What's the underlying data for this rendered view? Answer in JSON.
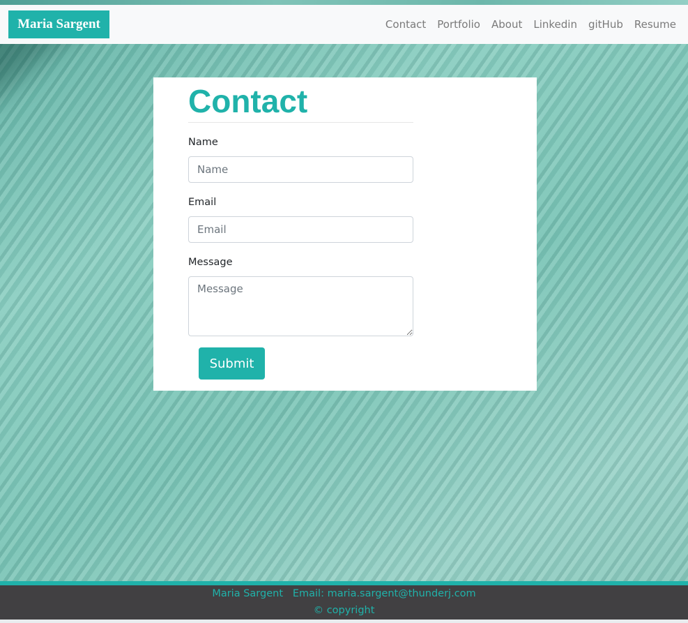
{
  "navbar": {
    "brand": "Maria Sargent",
    "links": [
      "Contact",
      "Portfolio",
      "About",
      "Linkedin",
      "gitHub",
      "Resume"
    ]
  },
  "contact": {
    "title": "Contact",
    "name_label": "Name",
    "name_placeholder": "Name",
    "email_label": "Email",
    "email_placeholder": "Email",
    "message_label": "Message",
    "message_placeholder": "Message",
    "submit_label": "Submit"
  },
  "footer": {
    "name": "Maria Sargent",
    "email_text": "Email: maria.sargent@thunderj.com",
    "copyright": "© copyright"
  },
  "colors": {
    "accent": "#20b2aa",
    "footer_bg": "#414042",
    "navbar_bg": "#f8f9fa"
  }
}
